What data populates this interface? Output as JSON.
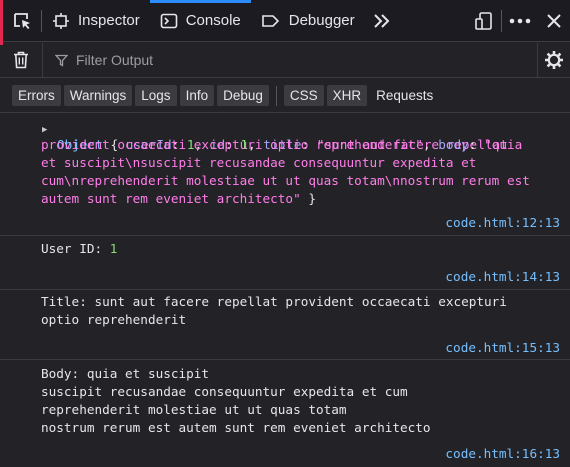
{
  "toolbar": {
    "tabs": [
      {
        "label": "Inspector",
        "icon": "inspector-icon"
      },
      {
        "label": "Console",
        "icon": "console-icon"
      },
      {
        "label": "Debugger",
        "icon": "debugger-icon"
      }
    ],
    "active_tab": "Console"
  },
  "filter": {
    "placeholder": "Filter Output"
  },
  "chips": [
    "Errors",
    "Warnings",
    "Logs",
    "Info",
    "Debug",
    "CSS",
    "XHR",
    "Requests"
  ],
  "colors": {
    "accent": "#2b8dff",
    "link": "#75bfff",
    "string": "#ff7de9",
    "number": "#86de74",
    "key": "#a5a5f8"
  },
  "logs": [
    {
      "object": {
        "type_label": "Object",
        "open": "{",
        "keys": [
          "userId",
          "id",
          "title",
          "body"
        ],
        "userId": "1",
        "id": "1",
        "title": "\"sunt aut facere repellat provident occaecati excepturi optio reprehenderit\"",
        "body": "\"quia et suscipit\\nsuscipit recusandae consequuntur expedita et cum\\nreprehenderit molestiae ut ut quas totam\\nnostrum rerum est autem sunt rem eveniet architecto\"",
        "close": "}"
      },
      "location": "code.html:12:13"
    },
    {
      "label": "User ID:",
      "value": "1",
      "location": "code.html:14:13"
    },
    {
      "text": "Title: sunt aut facere repellat provident occaecati excepturi optio reprehenderit",
      "location": "code.html:15:13"
    },
    {
      "text": "Body: quia et suscipit\nsuscipit recusandae consequuntur expedita et cum\nreprehenderit molestiae ut ut quas totam\nnostrum rerum est autem sunt rem eveniet architecto",
      "location": "code.html:16:13"
    }
  ]
}
